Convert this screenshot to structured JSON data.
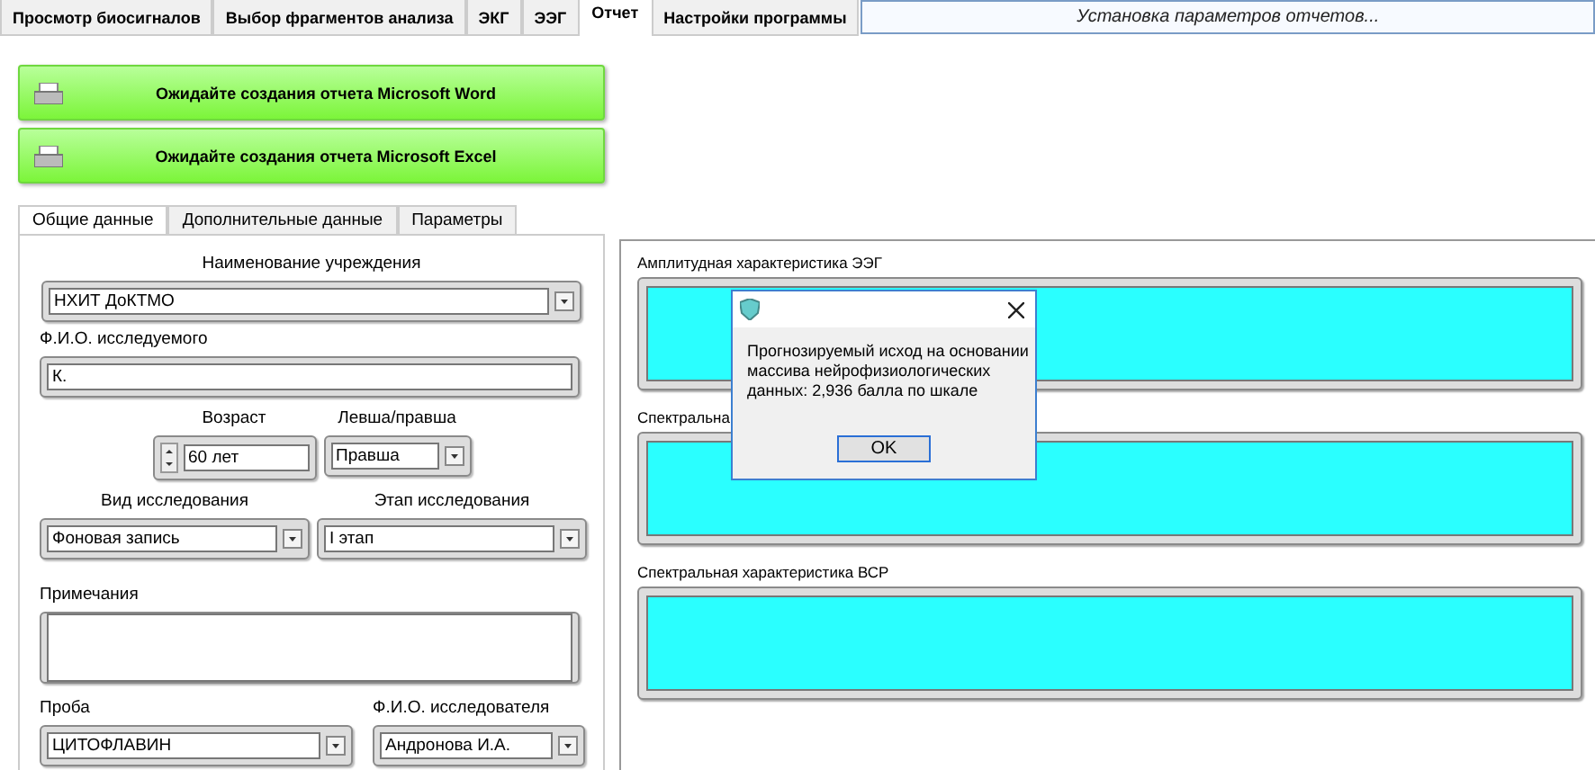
{
  "main_tabs": [
    {
      "label": "Просмотр биосигналов",
      "selected": false
    },
    {
      "label": "Выбор фрагментов анализа",
      "selected": false
    },
    {
      "label": "ЭКГ",
      "selected": false
    },
    {
      "label": "ЭЭГ",
      "selected": false
    },
    {
      "label": "Отчет",
      "selected": true
    },
    {
      "label": "Настройки программы",
      "selected": false
    }
  ],
  "status_field": {
    "value": "Установка параметров отчетов..."
  },
  "report_buttons": [
    {
      "label": "Ожидайте создания отчета Microsoft Word"
    },
    {
      "label": "Ожидайте создания отчета Microsoft Excel"
    }
  ],
  "sub_tabs": [
    {
      "label": "Общие данные",
      "selected": true
    },
    {
      "label": "Дополнительные данные",
      "selected": false
    },
    {
      "label": "Параметры",
      "selected": false
    }
  ],
  "form": {
    "institution": {
      "label": "Наименование учреждения",
      "kind": "dropdown",
      "value": "НХИТ ДоКТМО"
    },
    "subject_name": {
      "label": "Ф.И.О. исследуемого",
      "kind": "text",
      "value": "К."
    },
    "age": {
      "label": "Возраст",
      "kind": "spinner",
      "value": "60 лет"
    },
    "handedness": {
      "label": "Левша/правша",
      "kind": "dropdown",
      "value": "Правша"
    },
    "study_type": {
      "label": "Вид исследования",
      "kind": "dropdown",
      "value": "Фоновая запись"
    },
    "study_stage": {
      "label": "Этап исследования",
      "kind": "dropdown",
      "value": "I этап"
    },
    "notes": {
      "label": "Примечания",
      "kind": "textarea"
    },
    "sample": {
      "label": "Проба",
      "kind": "dropdown",
      "value": "ЦИТОФЛАВИН"
    },
    "researcher": {
      "label": "Ф.И.О. исследователя",
      "kind": "dropdown",
      "value": "Андронова И.А."
    }
  },
  "charts": [
    {
      "title": "Амплитудная характеристика ЭЭГ"
    },
    {
      "title": "Спектральна"
    },
    {
      "title": "Спектральная характеристика ВСР"
    }
  ],
  "dialog": {
    "message": "Прогнозируемый исход на основании\nмассива нейрофизиологических\nданных:  2,936 балла по шкале",
    "button": "OK"
  }
}
